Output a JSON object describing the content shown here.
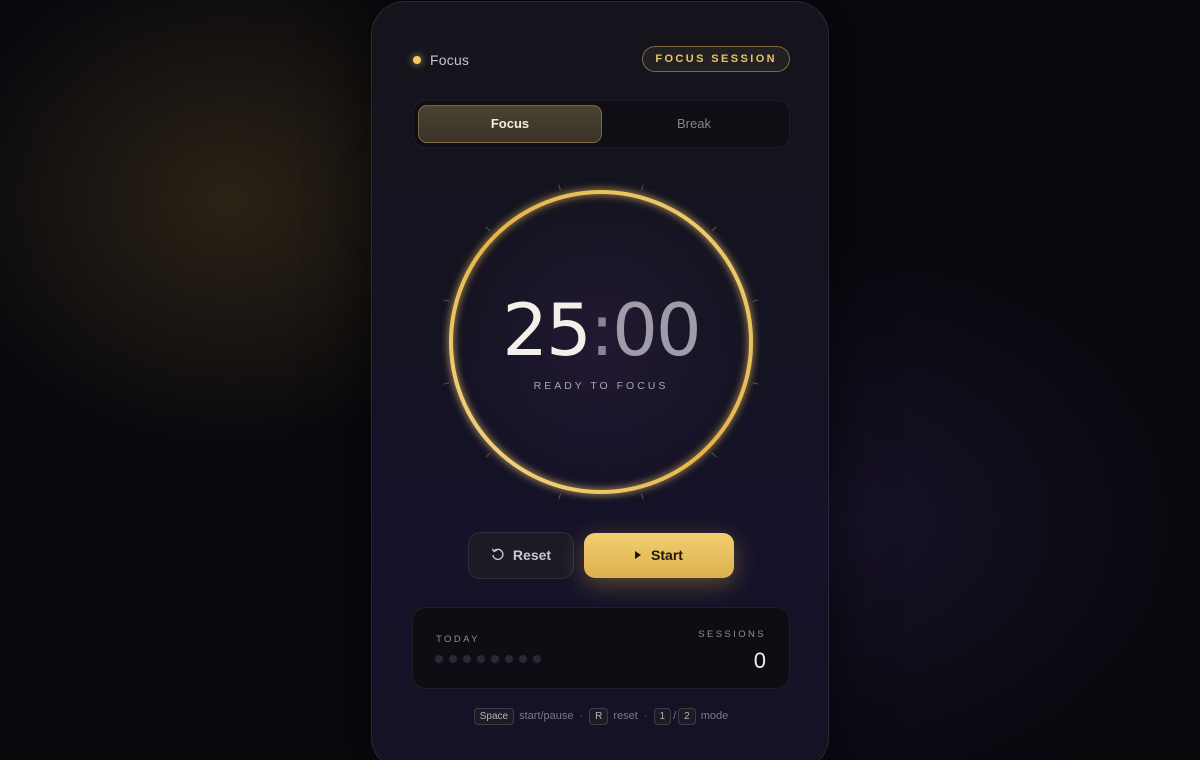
{
  "header": {
    "mode_label": "Focus",
    "session_badge": "FOCUS SESSION",
    "accent_color": "#f0cc62"
  },
  "mode_toggle": {
    "options": [
      {
        "label": "Focus",
        "active": true
      },
      {
        "label": "Break",
        "active": false
      }
    ]
  },
  "timer": {
    "minutes": "25",
    "colon": ":",
    "seconds": "00",
    "status": "READY TO FOCUS",
    "progress": 1.0,
    "ring_color": "#e8b94f"
  },
  "controls": {
    "reset_label": "Reset",
    "reset_icon": "reset-icon",
    "start_label": "Start",
    "start_icon": "play-icon"
  },
  "stats": {
    "today_label": "TODAY",
    "today_dots_total": 8,
    "today_dots_filled": 0,
    "sessions_label": "SESSIONS",
    "sessions_count": "0"
  },
  "shortcuts": [
    {
      "keys": [
        "Space"
      ],
      "action": "start/pause"
    },
    {
      "keys": [
        "R"
      ],
      "action": "reset"
    },
    {
      "keys": [
        "1",
        "2"
      ],
      "action": "mode"
    }
  ]
}
